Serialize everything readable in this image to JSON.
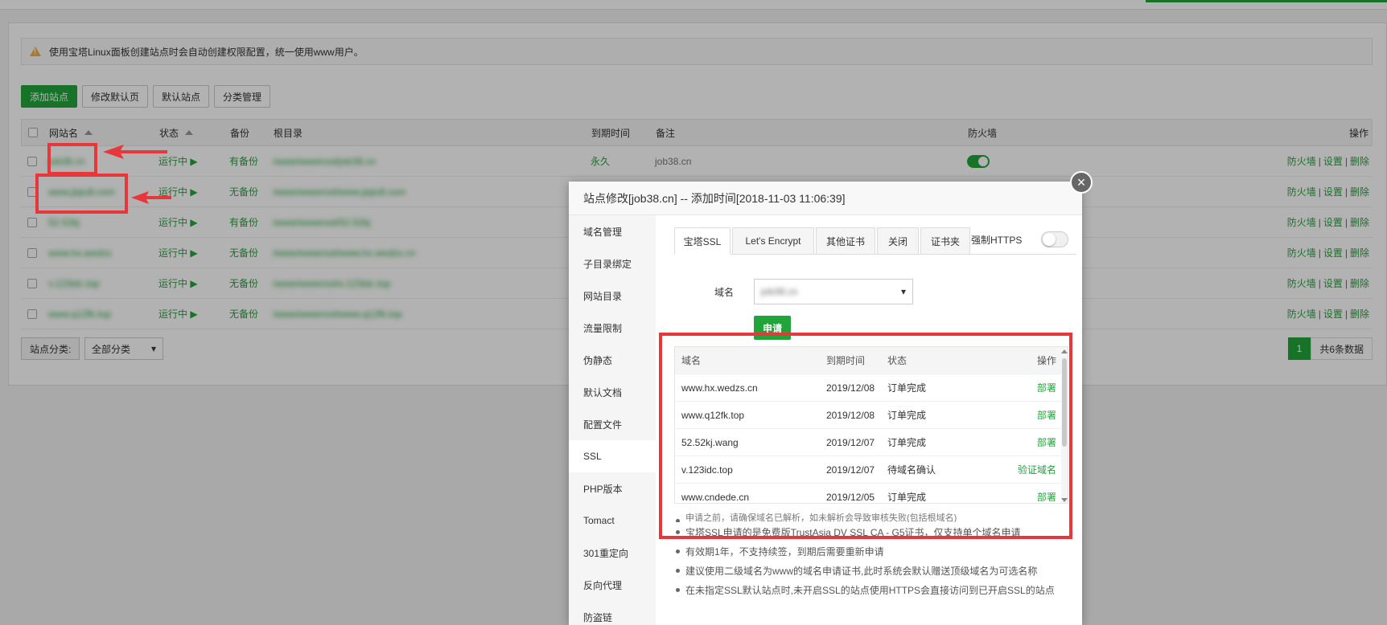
{
  "notice": {
    "text": "使用宝塔Linux面板创建站点时会自动创建权限配置，统一使用www用户。"
  },
  "toolbar": {
    "add_site": "添加站点",
    "edit_default_page": "修改默认页",
    "default_site": "默认站点",
    "category_manage": "分类管理"
  },
  "table": {
    "headers": {
      "site_name": "网站名",
      "status": "状态",
      "backup": "备份",
      "root_dir": "根目录",
      "expire": "到期时间",
      "remark": "备注",
      "firewall": "防火墙",
      "actions": "操作"
    },
    "rows": [
      {
        "name": "job38.cn",
        "status": "运行中 ▶",
        "backup": "有备份",
        "root": "/www/wwwroot/job38.cn",
        "expire": "永久",
        "remark": "job38.cn"
      },
      {
        "name": "www.jiqiu8.com",
        "status": "运行中 ▶",
        "backup": "无备份",
        "root": "/www/wwwroot/www.jiqiu8.com",
        "expire": "",
        "remark": ""
      },
      {
        "name": "52.52kj",
        "status": "运行中 ▶",
        "backup": "有备份",
        "root": "/www/wwwroot/52.52kj",
        "expire": "",
        "remark": ""
      },
      {
        "name": "www.hx.wedzs",
        "status": "运行中 ▶",
        "backup": "无备份",
        "root": "/www/wwwroot/www.hx.wedzs.cn",
        "expire": "",
        "remark": ""
      },
      {
        "name": "v.123idc.top",
        "status": "运行中 ▶",
        "backup": "无备份",
        "root": "/www/wwwroot/v.123idc.top",
        "expire": "",
        "remark": ""
      },
      {
        "name": "www.q12fk.top",
        "status": "运行中 ▶",
        "backup": "无备份",
        "root": "/www/wwwroot/www.q12fk.top",
        "expire": "",
        "remark": ""
      }
    ],
    "action_firewall": "防火墙",
    "action_settings": "设置",
    "action_delete": "删除",
    "separator": "|"
  },
  "footer": {
    "category_label": "站点分类:",
    "category_value": "全部分类",
    "page_current": "1",
    "total": "共6条数据"
  },
  "modal": {
    "title": "站点修改[job38.cn] -- 添加时间[2018-11-03 11:06:39]",
    "close": "×",
    "sidebar": [
      "域名管理",
      "子目录绑定",
      "网站目录",
      "流量限制",
      "伪静态",
      "默认文档",
      "配置文件",
      "SSL",
      "PHP版本",
      "Tomact",
      "301重定向",
      "反向代理",
      "防盗链"
    ],
    "tabs": [
      "宝塔SSL",
      "Let's Encrypt",
      "其他证书",
      "关闭",
      "证书夹"
    ],
    "force_https": "强制HTTPS",
    "domain_label": "域名",
    "domain_value": "job38.cn",
    "apply": "申请",
    "cert_headers": {
      "domain": "域名",
      "expire": "到期时间",
      "status": "状态",
      "action": "操作"
    },
    "certs": [
      {
        "domain": "www.hx.wedzs.cn",
        "expire": "2019/12/08",
        "status": "订单完成",
        "action": "部署"
      },
      {
        "domain": "www.q12fk.top",
        "expire": "2019/12/08",
        "status": "订单完成",
        "action": "部署"
      },
      {
        "domain": "52.52kj.wang",
        "expire": "2019/12/07",
        "status": "订单完成",
        "action": "部署"
      },
      {
        "domain": "v.123idc.top",
        "expire": "2019/12/07",
        "status": "待域名确认",
        "action": "验证域名"
      },
      {
        "domain": "www.cndede.cn",
        "expire": "2019/12/05",
        "status": "订单完成",
        "action": "部署"
      }
    ],
    "notes": [
      "申请之前，请确保域名已解析，如未解析会导致审核失败(包括根域名)",
      "宝塔SSL申请的是免费版TrustAsia DV SSL CA - G5证书，仅支持单个域名申请",
      "有效期1年，不支持续签，到期后需要重新申请",
      "建议使用二级域名为www的域名申请证书,此时系统会默认赠送顶级域名为可选名称",
      "在未指定SSL默认站点时,未开启SSL的站点使用HTTPS会直接访问到已开启SSL的站点"
    ]
  },
  "colors": {
    "accent": "#20a53a",
    "annotation_red": "#e8373a"
  }
}
